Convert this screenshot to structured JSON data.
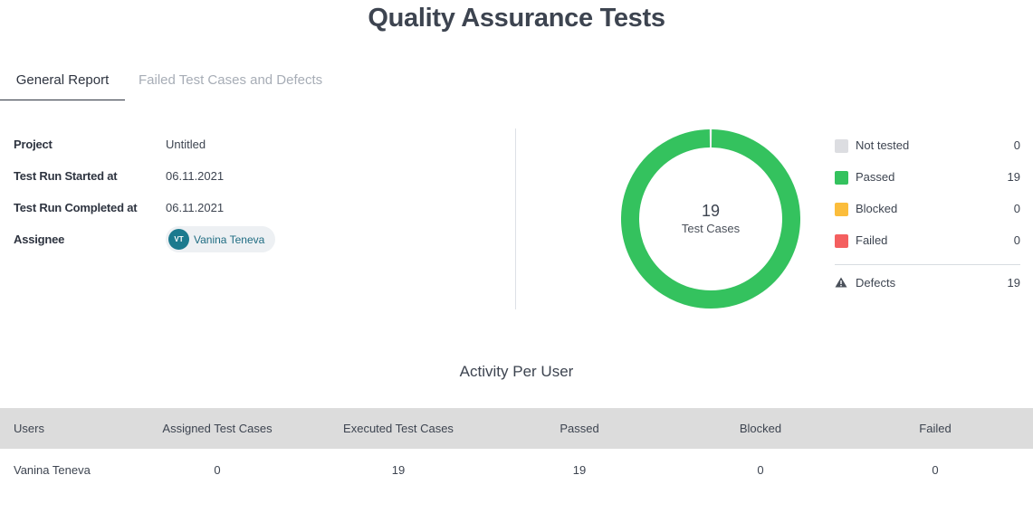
{
  "page_title": "Quality Assurance Tests",
  "tabs": [
    {
      "label": "General Report",
      "active": true
    },
    {
      "label": "Failed Test Cases and Defects",
      "active": false
    }
  ],
  "info": {
    "project_label": "Project",
    "project_value": "Untitled",
    "started_label": "Test Run Started at",
    "started_value": "06.11.2021",
    "completed_label": "Test Run Completed at",
    "completed_value": "06.11.2021",
    "assignee_label": "Assignee",
    "assignee_initials": "VT",
    "assignee_name": "Vanina Teneva"
  },
  "summary": {
    "total": "19",
    "total_label": "Test Cases",
    "legend": [
      {
        "label": "Not tested",
        "count": "0",
        "value": 0,
        "color": "#dcdde1"
      },
      {
        "label": "Passed",
        "count": "19",
        "value": 19,
        "color": "#34c25e"
      },
      {
        "label": "Blocked",
        "count": "0",
        "value": 0,
        "color": "#fbbd3c"
      },
      {
        "label": "Failed",
        "count": "0",
        "value": 0,
        "color": "#f45f5f"
      }
    ],
    "defects_label": "Defects",
    "defects_count": "19",
    "defects_icon": "warning-icon"
  },
  "activity": {
    "title": "Activity Per User",
    "columns": [
      "Users",
      "Assigned Test Cases",
      "Executed Test Cases",
      "Passed",
      "Blocked",
      "Failed"
    ],
    "rows": [
      [
        "Vanina Teneva",
        "0",
        "19",
        "19",
        "0",
        "0"
      ]
    ]
  }
}
